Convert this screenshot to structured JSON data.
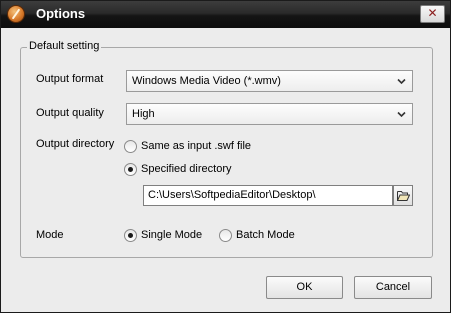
{
  "window": {
    "title": "Options",
    "close_glyph": "✕"
  },
  "group": {
    "legend": "Default setting"
  },
  "output_format": {
    "label": "Output format",
    "value": "Windows Media Video (*.wmv)"
  },
  "output_quality": {
    "label": "Output quality",
    "value": "High"
  },
  "output_directory": {
    "label": "Output directory",
    "options": [
      {
        "label": "Same as input .swf file",
        "checked": false
      },
      {
        "label": "Specified directory",
        "checked": true
      }
    ],
    "path": "C:\\Users\\SoftpediaEditor\\Desktop\\"
  },
  "mode": {
    "label": "Mode",
    "options": [
      {
        "label": "Single Mode",
        "checked": true
      },
      {
        "label": "Batch Mode",
        "checked": false
      }
    ]
  },
  "buttons": {
    "ok": "OK",
    "cancel": "Cancel"
  },
  "icons": {
    "app": "app-logo-icon",
    "close": "close-icon",
    "dropdown": "chevron-down-icon",
    "browse": "folder-open-icon"
  }
}
